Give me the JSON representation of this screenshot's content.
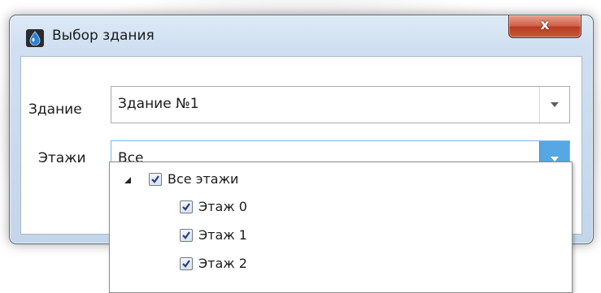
{
  "window": {
    "title": "Выбор здания",
    "close_glyph": "x"
  },
  "form": {
    "building_label": "Здание",
    "building_value": "Здание №1",
    "floors_label": "Этажи",
    "floors_value": "Все"
  },
  "floors_tree": {
    "root": {
      "label": "Все этажи",
      "checked": true,
      "expanded": true
    },
    "children": [
      {
        "label": "Этаж 0",
        "checked": true
      },
      {
        "label": "Этаж 1",
        "checked": true
      },
      {
        "label": "Этаж 2",
        "checked": true
      }
    ]
  },
  "icons": {
    "app": "water-drop-icon",
    "close": "close-icon",
    "dropdown": "chevron-down-icon",
    "expander": "triangle-expanded-icon",
    "checkbox": "checkmark-icon"
  },
  "colors": {
    "close_button": "#c75a3e",
    "dropdown_active": "#56a7e4",
    "checkmark": "#1e3f8a"
  }
}
